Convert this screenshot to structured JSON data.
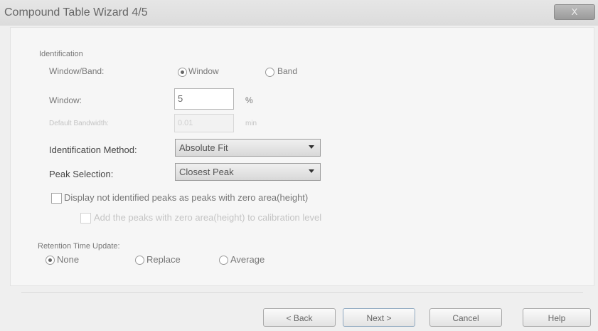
{
  "window": {
    "title": "Compound Table Wizard 4/5",
    "close_label": "X"
  },
  "identification": {
    "group_label": "Identification",
    "window_band_label": "Window/Band:",
    "option_window": "Window",
    "option_band": "Band",
    "selected_mode": "Window",
    "window_label": "Window:",
    "window_value": "5",
    "window_unit": "%",
    "default_bandwidth_label": "Default Bandwidth:",
    "default_bandwidth_value": "0.01",
    "default_bandwidth_unit": "min",
    "method_label": "Identification Method:",
    "method_value": "Absolute Fit",
    "peak_selection_label": "Peak Selection:",
    "peak_selection_value": "Closest Peak",
    "display_not_identified_label": "Display not identified peaks as peaks with zero area(height)",
    "add_peaks_label": "Add the peaks with zero area(height) to calibration level"
  },
  "retention": {
    "group_label": "Retention Time Update:",
    "option_none": "None",
    "option_replace": "Replace",
    "option_average": "Average",
    "selected": "None"
  },
  "buttons": {
    "back": "< Back",
    "next": "Next >",
    "cancel": "Cancel",
    "help": "Help"
  }
}
